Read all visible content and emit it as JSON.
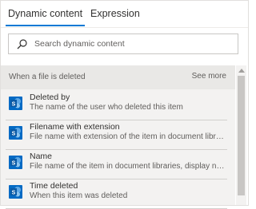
{
  "tabs": [
    {
      "label": "Dynamic content",
      "active": true
    },
    {
      "label": "Expression",
      "active": false
    }
  ],
  "search": {
    "placeholder": "Search dynamic content",
    "value": ""
  },
  "section": {
    "title": "When a file is deleted",
    "see_more": "See more",
    "items": [
      {
        "title": "Deleted by",
        "description": "The name of the user who deleted this item",
        "icon": "sharepoint-icon"
      },
      {
        "title": "Filename with extension",
        "description": "File name with extension of the item in document librari...",
        "icon": "sharepoint-icon"
      },
      {
        "title": "Name",
        "description": "File name of the item in document libraries, display nam...",
        "icon": "sharepoint-icon"
      },
      {
        "title": "Time deleted",
        "description": "When this item was deleted",
        "icon": "sharepoint-icon"
      }
    ]
  },
  "colors": {
    "accent": "#0078d4",
    "icon_bg": "#036ac4"
  }
}
